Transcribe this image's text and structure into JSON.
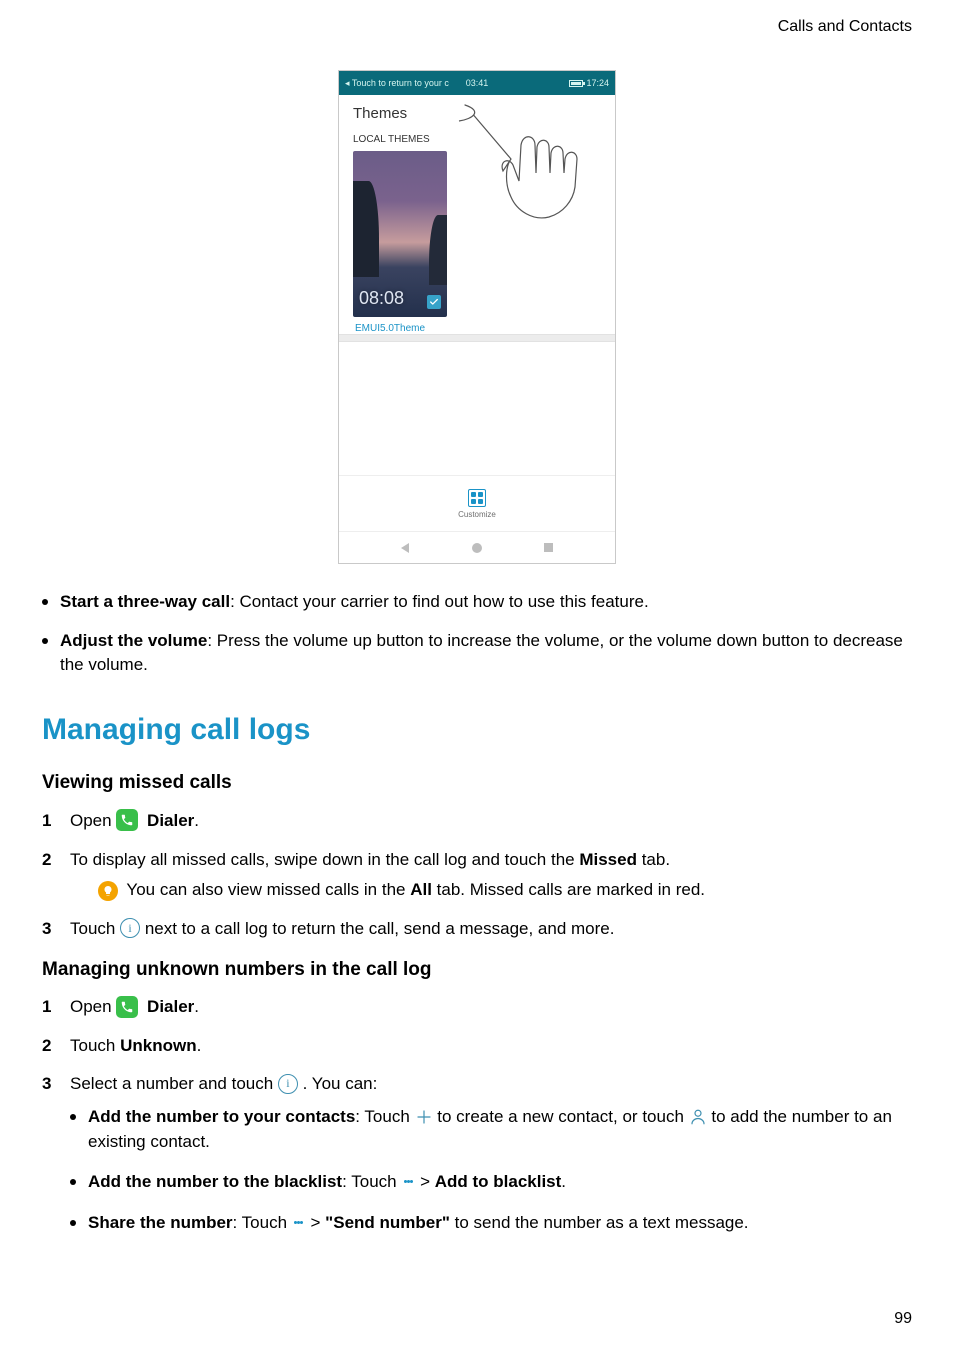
{
  "header": {
    "breadcrumb": "Calls and Contacts"
  },
  "phone": {
    "statusbar": {
      "left": "◂ Touch to return to your c",
      "center": "03:41",
      "right_time": "17:24"
    },
    "title": "Themes",
    "local_label": "LOCAL THEMES",
    "clock": "08:08",
    "theme_name": "EMUI5.0Theme",
    "customize_label": "Customize"
  },
  "bullets_top": [
    {
      "strong": "Start a three-way call",
      "rest": ": Contact your carrier to find out how to use this feature."
    },
    {
      "strong": "Adjust the volume",
      "rest": ": Press the volume up button to increase the volume, or the volume down button to decrease the volume."
    }
  ],
  "section_title": "Managing call logs",
  "sub1": {
    "title": "Viewing missed calls",
    "steps": {
      "s1_pre": "Open ",
      "s1_bold": "Dialer",
      "s1_post": ".",
      "s2_a": "To display all missed calls, swipe down in the call log and touch the ",
      "s2_bold": "Missed",
      "s2_b": " tab.",
      "s2_note_a": "You can also view missed calls in the ",
      "s2_note_bold": "All",
      "s2_note_b": " tab. Missed calls are marked in red.",
      "s3_a": "Touch ",
      "s3_b": " next to a call log to return the call, send a message, and more."
    }
  },
  "sub2": {
    "title": "Managing unknown numbers in the call log",
    "steps": {
      "s1_pre": "Open ",
      "s1_bold": "Dialer",
      "s1_post": ".",
      "s2_a": "Touch ",
      "s2_bold": "Unknown",
      "s2_b": ".",
      "s3_a": "Select a number and touch ",
      "s3_b": ". You can:"
    },
    "nested": {
      "n1_strong": "Add the number to your contacts",
      "n1_a": ": Touch ",
      "n1_b": " to create a new contact, or touch ",
      "n1_c": " to add the number to an existing contact.",
      "n2_strong": "Add the number to the blacklist",
      "n2_a": ": Touch ",
      "n2_b": " > ",
      "n2_bold": "Add to blacklist",
      "n2_c": ".",
      "n3_strong": "Share the number",
      "n3_a": ": Touch ",
      "n3_b": " > ",
      "n3_bold": "\"Send number\"",
      "n3_c": " to send the number as a text message."
    }
  },
  "page_number": "99"
}
